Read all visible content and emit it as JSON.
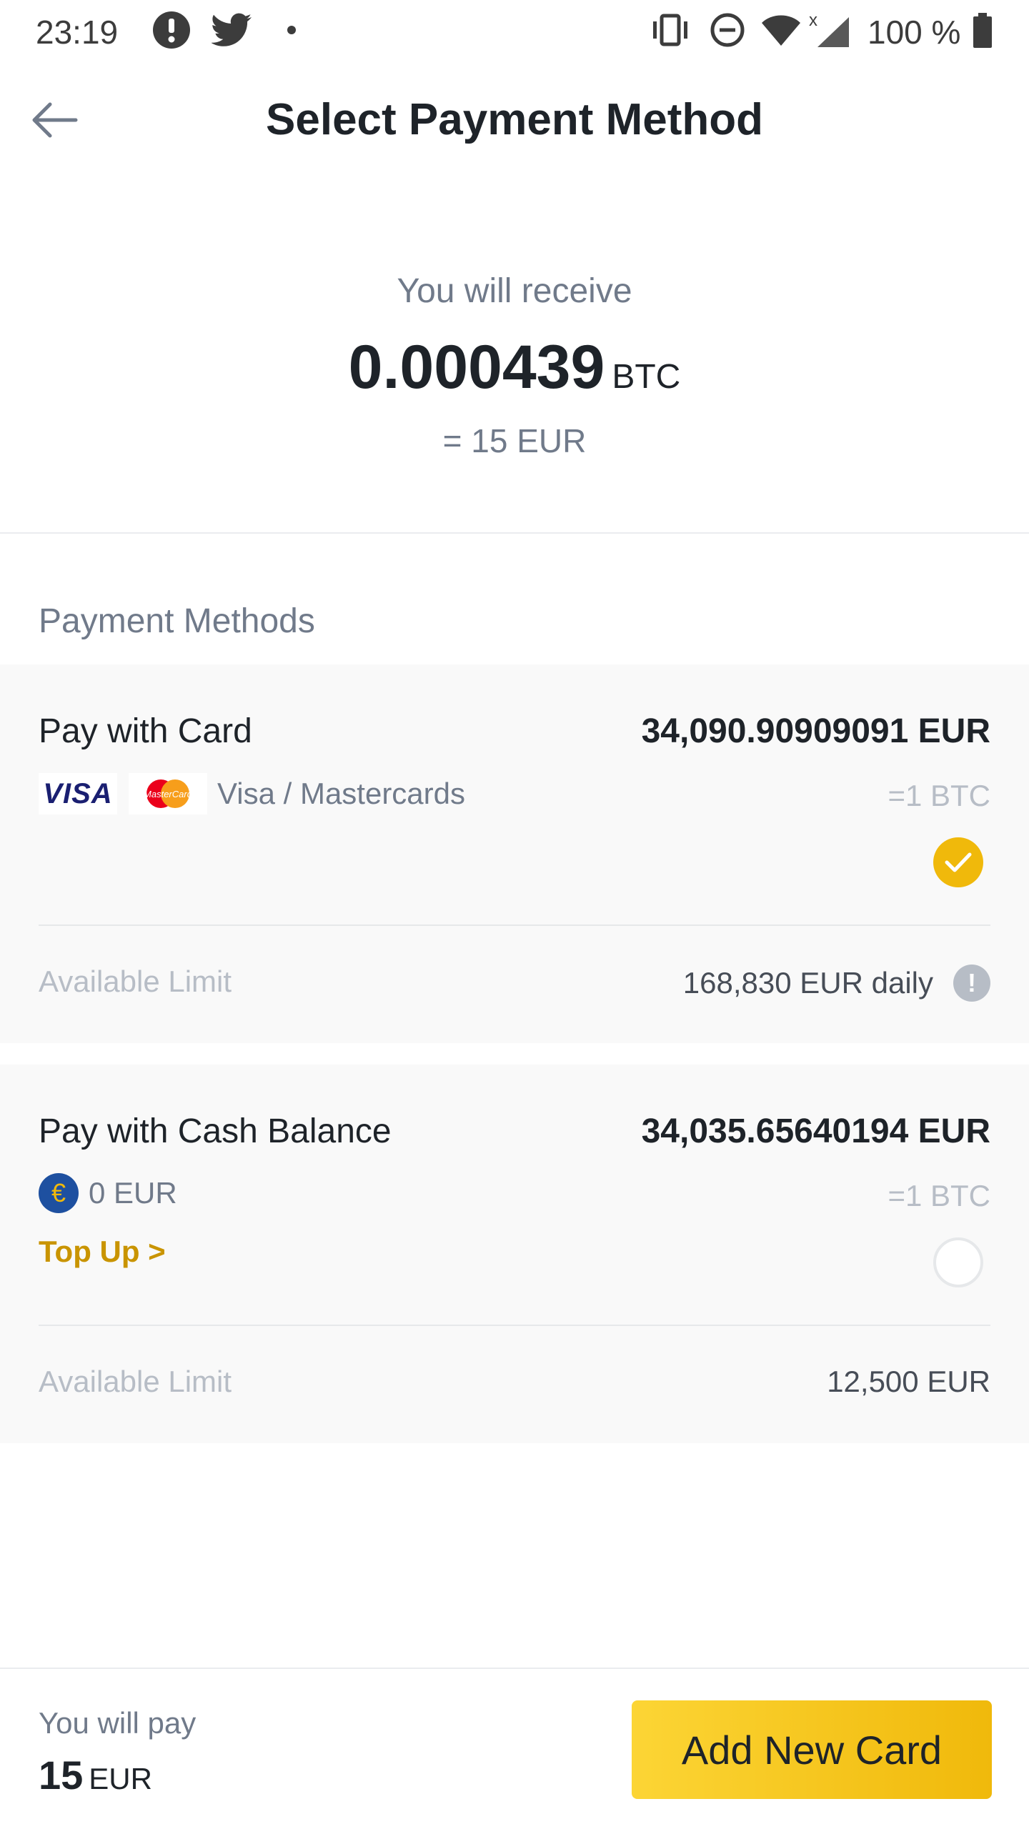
{
  "status_bar": {
    "time": "23:19",
    "battery": "100 %",
    "icons": [
      "info-icon",
      "twitter-icon",
      "dot-icon",
      "vibrate-icon",
      "dnd-icon",
      "wifi-icon",
      "signal-icon",
      "battery-icon"
    ]
  },
  "header": {
    "title": "Select Payment Method",
    "back_icon": "arrow-left-icon"
  },
  "receive": {
    "label": "You will receive",
    "amount": "0.000439",
    "unit": "BTC",
    "fiat": "= 15 EUR"
  },
  "payment_methods": {
    "section_label": "Payment Methods",
    "card": {
      "title": "Pay with Card",
      "price": "34,090.90909091 EUR",
      "visa_text": "VISA",
      "mc_text": "MasterCard",
      "subtitle": "Visa / Mastercards",
      "rate": "=1 BTC",
      "selected": true,
      "limit_label": "Available Limit",
      "limit_value": "168,830 EUR daily",
      "info_glyph": "!"
    },
    "cash": {
      "title": "Pay with Cash Balance",
      "price": "34,035.65640194 EUR",
      "currency_glyph": "€",
      "balance": "0 EUR",
      "topup": "Top Up >",
      "rate": "=1 BTC",
      "selected": false,
      "limit_label": "Available Limit",
      "limit_value": "12,500 EUR"
    }
  },
  "footer": {
    "pay_label": "You will pay",
    "pay_amount": "15",
    "pay_unit": "EUR",
    "button_label": "Add New Card"
  },
  "colors": {
    "accent": "#f0b90b",
    "accent_light": "#fcd535",
    "link": "#c99400",
    "text_primary": "#1e2329",
    "text_secondary": "#707a8a"
  }
}
